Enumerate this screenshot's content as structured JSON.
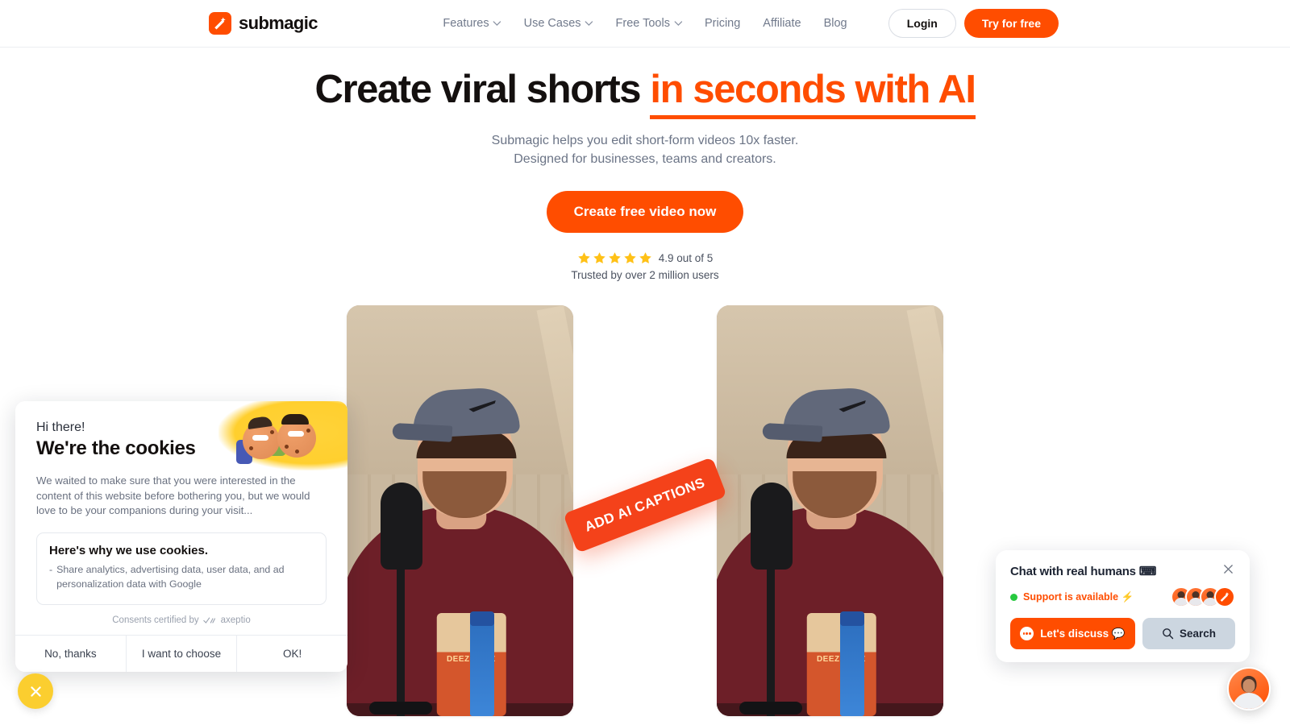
{
  "brand": {
    "name": "submagic",
    "logo_icon": "magic-wand-icon"
  },
  "nav": {
    "items": [
      {
        "label": "Features",
        "has_dropdown": true
      },
      {
        "label": "Use Cases",
        "has_dropdown": true
      },
      {
        "label": "Free Tools",
        "has_dropdown": true
      },
      {
        "label": "Pricing",
        "has_dropdown": false
      },
      {
        "label": "Affiliate",
        "has_dropdown": false
      },
      {
        "label": "Blog",
        "has_dropdown": false
      }
    ],
    "login_label": "Login",
    "try_label": "Try for free"
  },
  "hero": {
    "title_plain": "Create viral shorts",
    "title_accent": "in seconds with AI",
    "subtitle_line1": "Submagic helps you edit short-form videos 10x faster.",
    "subtitle_line2": "Designed for businesses, teams and creators.",
    "cta_label": "Create free video now",
    "rating_value": "4.9 out of 5",
    "rating_stars": 5,
    "trusted_text": "Trusted by over 2 million users"
  },
  "showcase": {
    "badge_label": "ADD AI CAPTIONS",
    "left_video_alt": "creator speaking into microphone, before captions",
    "right_video_alt": "creator speaking into microphone, after AI captions",
    "snack_label": "DEEZ NUTZ"
  },
  "cookie_banner": {
    "greeting": "Hi there!",
    "title": "We're the cookies",
    "body": "We waited to make sure that you were interested in the content of this website before bothering you, but we would love to be your companions during your visit...",
    "why_title": "Here's why we use cookies.",
    "why_items": [
      "Share analytics, advertising data, user data, and ad personalization data with Google"
    ],
    "certified_prefix": "Consents certified by",
    "certified_brand": "axeptio",
    "buttons": [
      {
        "label": "No, thanks"
      },
      {
        "label": "I want to choose"
      },
      {
        "label": "OK!"
      }
    ],
    "close_icon": "close-icon",
    "close_button_color": "#fbce2f"
  },
  "chat_widget": {
    "title": "Chat with real humans ⌨",
    "status": "Support is available ⚡",
    "status_dot_color": "#27c93f",
    "discuss_label": "Let's discuss 💬",
    "search_label": "Search",
    "close_icon": "close-icon",
    "agent_count": 4
  },
  "colors": {
    "accent": "#ff4d00",
    "badge": "#f4421a",
    "text_dark": "#14100f",
    "text_muted": "#6b7486",
    "star": "#ffc117",
    "cookie_yellow": "#fbce2f",
    "search_button": "#ccd6e0"
  }
}
